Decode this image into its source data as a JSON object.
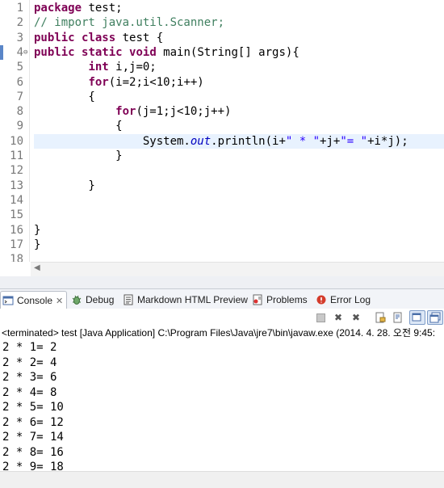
{
  "editor": {
    "line_numbers": [
      "1",
      "2",
      "3",
      "4",
      "5",
      "6",
      "7",
      "8",
      "9",
      "10",
      "11",
      "12",
      "13",
      "14",
      "15",
      "16",
      "17",
      "18"
    ],
    "fold_marker": "⊖",
    "lines": [
      [
        {
          "t": "package",
          "c": "kw"
        },
        {
          "t": " test;",
          "c": ""
        }
      ],
      [
        {
          "t": "// import java.util.Scanner;",
          "c": "cm"
        }
      ],
      [
        {
          "t": "public",
          "c": "kw"
        },
        {
          "t": " ",
          "c": ""
        },
        {
          "t": "class",
          "c": "kw"
        },
        {
          "t": " test {",
          "c": ""
        }
      ],
      [
        {
          "t": "public",
          "c": "kw"
        },
        {
          "t": " ",
          "c": ""
        },
        {
          "t": "static",
          "c": "kw"
        },
        {
          "t": " ",
          "c": ""
        },
        {
          "t": "void",
          "c": "kw"
        },
        {
          "t": " main(String[] args){",
          "c": ""
        }
      ],
      [
        {
          "t": "        ",
          "c": ""
        },
        {
          "t": "int",
          "c": "kw"
        },
        {
          "t": " i,j=0;",
          "c": ""
        }
      ],
      [
        {
          "t": "        ",
          "c": ""
        },
        {
          "t": "for",
          "c": "kw"
        },
        {
          "t": "(i=2;i<10;i++)",
          "c": ""
        }
      ],
      [
        {
          "t": "        {",
          "c": ""
        }
      ],
      [
        {
          "t": "            ",
          "c": ""
        },
        {
          "t": "for",
          "c": "kw"
        },
        {
          "t": "(j=1;j<10;j++)",
          "c": ""
        }
      ],
      [
        {
          "t": "            {",
          "c": ""
        }
      ],
      [
        {
          "t": "                System.",
          "c": ""
        },
        {
          "t": "out",
          "c": "fi"
        },
        {
          "t": ".println(i+",
          "c": ""
        },
        {
          "t": "\" * \"",
          "c": "st"
        },
        {
          "t": "+j+",
          "c": ""
        },
        {
          "t": "\"= \"",
          "c": "st"
        },
        {
          "t": "+i*j);",
          "c": ""
        }
      ],
      [
        {
          "t": "            }",
          "c": ""
        }
      ],
      [],
      [
        {
          "t": "        }",
          "c": ""
        }
      ],
      [],
      [],
      [
        {
          "t": "}",
          "c": ""
        }
      ],
      [
        {
          "t": "}",
          "c": ""
        }
      ],
      []
    ]
  },
  "tabs": [
    {
      "label": "Console",
      "icon": "console-icon",
      "active": true,
      "close": "✕"
    },
    {
      "label": "Debug",
      "icon": "debug-icon",
      "active": false
    },
    {
      "label": "Markdown HTML Preview",
      "icon": "markdown-preview-icon",
      "active": false
    },
    {
      "label": "Problems",
      "icon": "problems-icon",
      "active": false
    },
    {
      "label": "Error Log",
      "icon": "error-log-icon",
      "active": false
    }
  ],
  "toolbar": [
    "terminate-icon",
    "remove-launch-icon",
    "remove-all-terminated-icon",
    "scroll-lock-icon",
    "word-wrap-icon",
    "pin-console-icon",
    "display-selected-console-icon",
    "open-console-icon"
  ],
  "console": {
    "status": "<terminated> test [Java Application] C:\\Program Files\\Java\\jre7\\bin\\javaw.exe (2014. 4. 28. 오전 9:45:",
    "output": [
      "2 * 1= 2",
      "2 * 2= 4",
      "2 * 3= 6",
      "2 * 4= 8",
      "2 * 5= 10",
      "2 * 6= 12",
      "2 * 7= 14",
      "2 * 8= 16",
      "2 * 9= 18"
    ]
  },
  "colors": {
    "keyword": "#7f0055",
    "comment": "#3f7f5f",
    "string": "#2a00ff",
    "field": "#0000c0",
    "current_line": "#e8f2fe"
  }
}
